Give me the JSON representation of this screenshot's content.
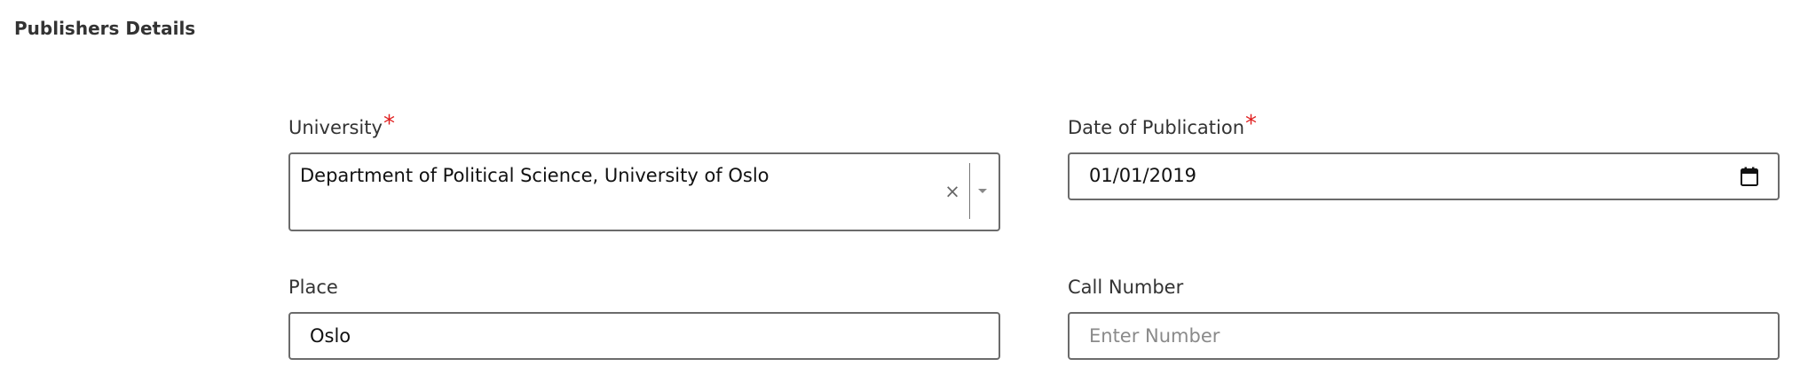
{
  "section": {
    "title": "Publishers Details"
  },
  "university": {
    "label": "University",
    "required_mark": "*",
    "value": "Department of Political Science, University of Oslo",
    "clear_glyph": "×"
  },
  "date_of_publication": {
    "label": "Date of Publication",
    "required_mark": "*",
    "value": "01/01/2019"
  },
  "place": {
    "label": "Place",
    "value": "Oslo"
  },
  "call_number": {
    "label": "Call Number",
    "value": "",
    "placeholder": "Enter Number"
  },
  "colors": {
    "required": "#e02020",
    "border": "#6b6b6b",
    "text": "#333333",
    "placeholder": "#8a8a8a"
  },
  "icons": {
    "clear": "close-icon",
    "dropdown": "chevron-down-icon",
    "calendar": "calendar-icon"
  }
}
